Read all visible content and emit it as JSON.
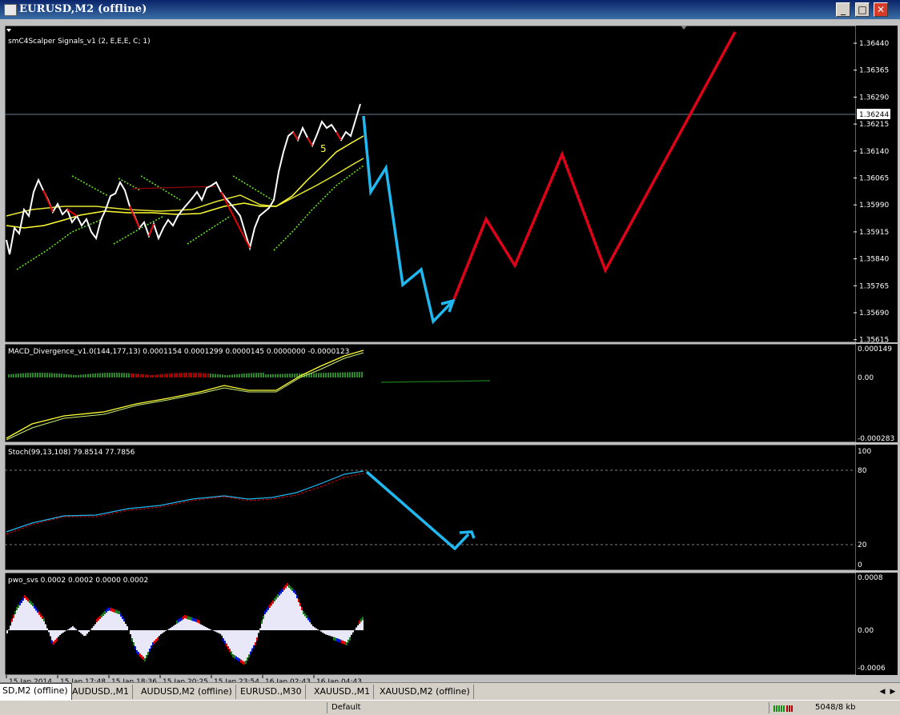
{
  "window": {
    "title": "EURUSD,M2 (offline)",
    "minimize_glyph": "_",
    "maximize_glyph": "□",
    "close_glyph": "✕"
  },
  "main_pane": {
    "indicator_label": "smC4Scalper Signals_v1 (2, E,E,E, C; 1)",
    "price_labels": [
      "1.36440",
      "1.36365",
      "1.36290",
      "1.36215",
      "1.36140",
      "1.36065",
      "1.35990",
      "1.35915",
      "1.35840",
      "1.35765",
      "1.35690",
      "1.35615"
    ],
    "current_price": "1.36244",
    "signal_marker": "5"
  },
  "macd_pane": {
    "label": "MACD_Divergence_v1.0(144,177,13) 0.0001154 0.0001299 0.0000145 0.0000000 -0.0000123",
    "scale": [
      "0.000149",
      "0.00",
      "-0.000283"
    ]
  },
  "stoch_pane": {
    "label": "Stoch(99,13,108) 79.8514 77.7856",
    "scale": [
      "100",
      "80",
      "20",
      "0"
    ]
  },
  "pwo_pane": {
    "label": "pwo_svs 0.0002 0.0002 0.0000 0.0002",
    "scale": [
      "0.0008",
      "0.00",
      "-0.0006"
    ]
  },
  "time_axis": [
    "15 Jan 2014",
    "15 Jan 17:48",
    "15 Jan 18:36",
    "15 Jan 20:25",
    "15 Jan 23:54",
    "16 Jan 02:43",
    "16 Jan 04:43"
  ],
  "tabs": [
    "SD,M2 (offline)",
    "AUDUSD.,M1",
    "AUDUSD,M2 (offline)",
    "EURUSD.,M30",
    "XAUUSD.,M1",
    "XAUUSD,M2 (offline)"
  ],
  "tab_scroll": {
    "left": "◀",
    "right": "▶"
  },
  "status": {
    "profile": "Default",
    "traffic": "5048/8 kb"
  },
  "colors": {
    "chart_bg": "#000000",
    "forecast_blue": "#1fb8f0",
    "forecast_red": "#e0001a",
    "ma_yellow": "#ffff33",
    "dots_green": "#66e022",
    "title_blue": "#0a246a"
  },
  "icons": [
    "app-icon",
    "minimize-icon",
    "maximize-icon",
    "close-icon",
    "dropdown-triangle-icon",
    "chart-shift-marker-icon",
    "signal-bars-icon"
  ]
}
